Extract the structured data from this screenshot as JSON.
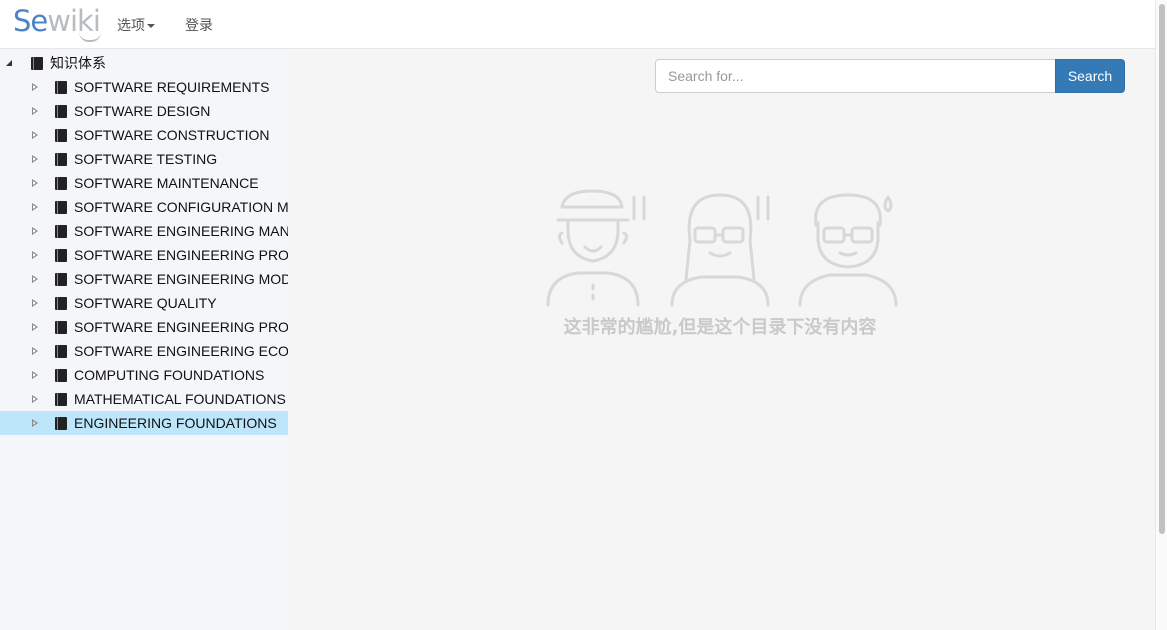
{
  "app": {
    "logo_prefix": "Se",
    "logo_suffix": "wiki",
    "nav": {
      "options_label": "选项",
      "login_label": "登录"
    }
  },
  "tree": {
    "root_label": "知识体系",
    "items": [
      {
        "label": "SOFTWARE REQUIREMENTS"
      },
      {
        "label": "SOFTWARE DESIGN"
      },
      {
        "label": "SOFTWARE CONSTRUCTION"
      },
      {
        "label": "SOFTWARE TESTING"
      },
      {
        "label": "SOFTWARE MAINTENANCE"
      },
      {
        "label": "SOFTWARE CONFIGURATION MANAGEMENT"
      },
      {
        "label": "SOFTWARE ENGINEERING MANAGEMENT"
      },
      {
        "label": "SOFTWARE ENGINEERING PROCESS"
      },
      {
        "label": "SOFTWARE ENGINEERING MODELS AND METHODS"
      },
      {
        "label": "SOFTWARE QUALITY"
      },
      {
        "label": "SOFTWARE ENGINEERING PROFESSIONAL PRACTICE"
      },
      {
        "label": "SOFTWARE ENGINEERING ECONOMICS"
      },
      {
        "label": "COMPUTING FOUNDATIONS"
      },
      {
        "label": "MATHEMATICAL FOUNDATIONS"
      },
      {
        "label": "ENGINEERING FOUNDATIONS",
        "selected": true
      }
    ]
  },
  "search": {
    "placeholder": "Search for...",
    "button_label": "Search"
  },
  "empty_state": {
    "message": "这非常的尴尬,但是这个目录下没有内容"
  },
  "colors": {
    "brand_blue": "#4a86c5",
    "button_blue": "#337ab7",
    "selected_row": "#bde6fb"
  }
}
